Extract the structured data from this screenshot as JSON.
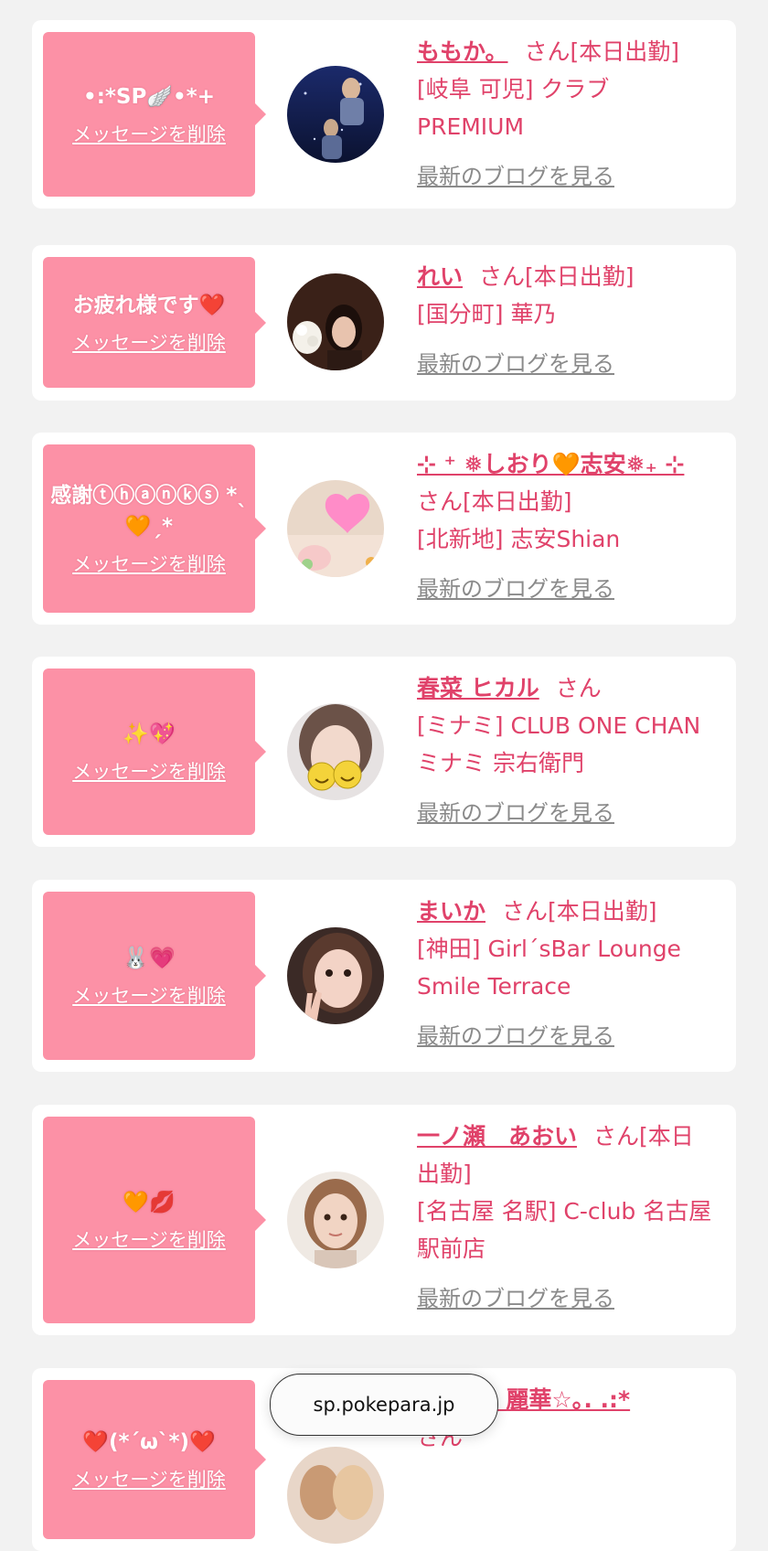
{
  "delete_label": "メッセージを削除",
  "blog_label": "最新のブログを見る",
  "san_label": "さん",
  "accent": "#fc91a6",
  "text_pink": "#e0426a",
  "cards": [
    {
      "message": "•:*SP🪽•*+",
      "name": "ももか。",
      "status": "[本日出勤]",
      "shop": "[岐阜 可児] クラブPREMIUM",
      "avatar_icon": "night-photo-avatar"
    },
    {
      "message": "お疲れ様です❤️",
      "name": "れい",
      "status": "[本日出勤]",
      "shop": "[国分町] 華乃",
      "avatar_icon": "woman-with-flowers-avatar"
    },
    {
      "message": "感謝ⓣⓗⓐⓝⓚⓢ *ˎ🧡ˏ*",
      "name": "⊹ ⁺ ❅しおり🧡志安❅₊ ⊹",
      "status": "[本日出勤]",
      "shop": "[北新地] 志安Shian",
      "avatar_icon": "heart-covered-face-avatar"
    },
    {
      "message": "✨💖",
      "name": "春菜 ヒカル",
      "status": "",
      "shop": "[ミナミ] CLUB ONE CHAN ミナミ 宗右衛門",
      "avatar_icon": "smiley-covered-face-avatar"
    },
    {
      "message": "🐰💗",
      "name": "まいか",
      "status": "[本日出勤]",
      "shop": "[神田] Girl´sBar Lounge Smile Terrace",
      "avatar_icon": "peace-sign-avatar"
    },
    {
      "message": "🧡💋",
      "name": "一ノ瀬　あおい",
      "status": "[本日出勤]",
      "shop": "[名古屋 名駅] C-club 名古屋駅前店",
      "avatar_icon": "woman-portrait-avatar"
    },
    {
      "message": "❤️(*´ω`*)❤️",
      "name": "☆竜宮　麗華☆｡. .:*",
      "status": "",
      "shop": "",
      "avatar_icon": "two-women-avatar"
    }
  ],
  "url_bar": "sp.pokepara.jp"
}
